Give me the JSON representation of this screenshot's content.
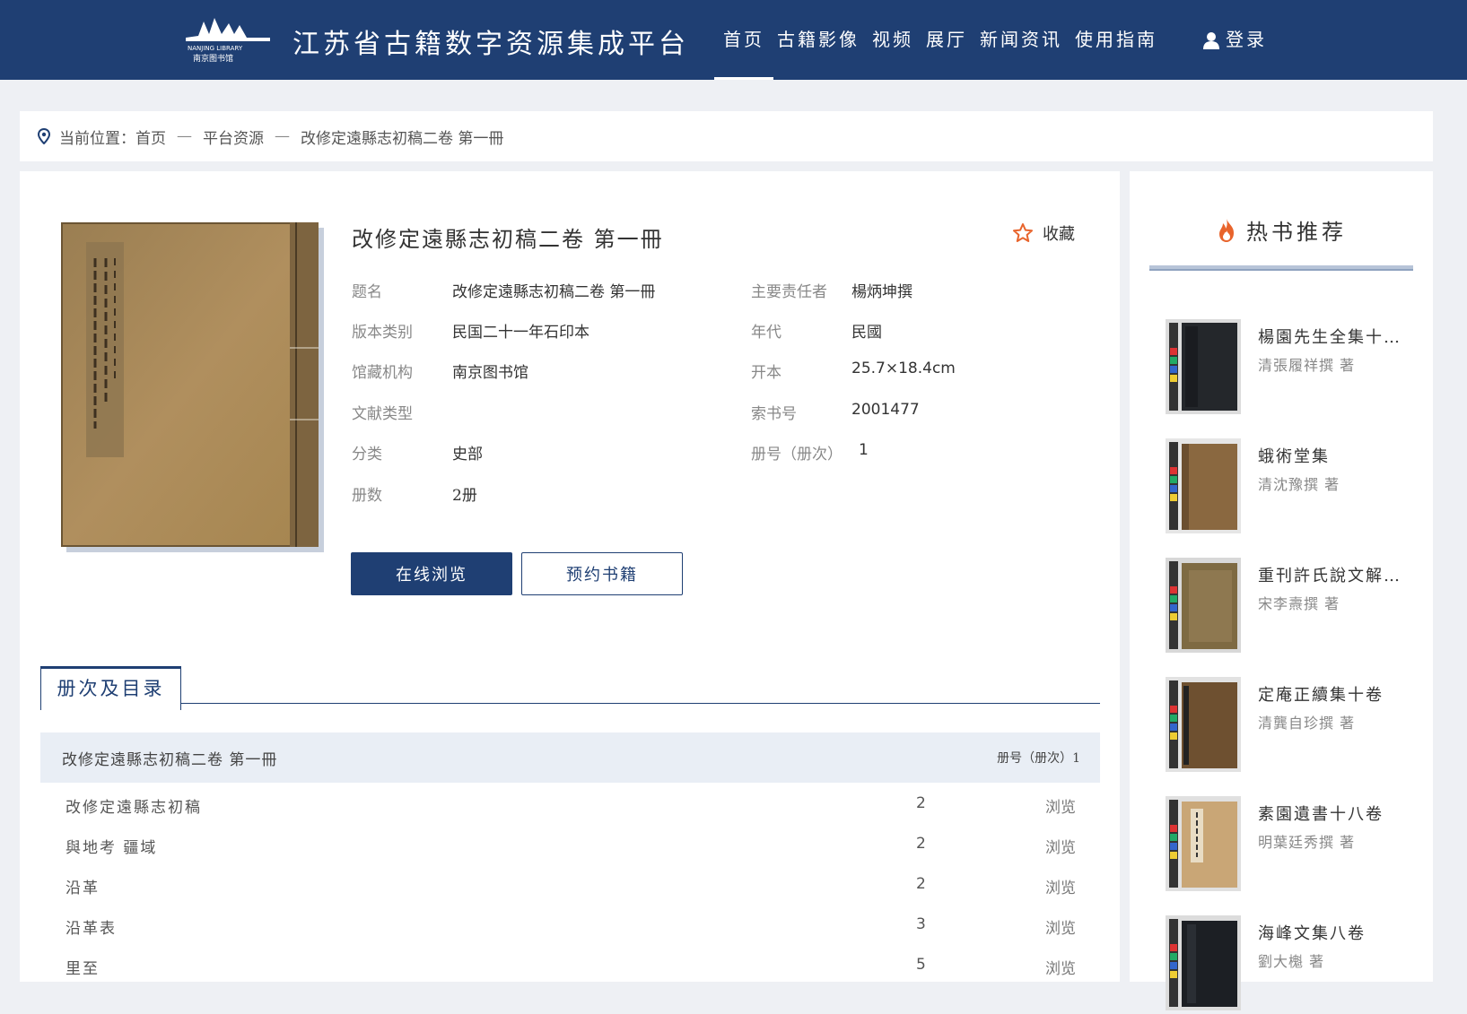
{
  "header": {
    "site_title": "江苏省古籍数字资源集成平台",
    "logo_text": "NANJING LIBRARY 南京图书馆",
    "nav": [
      "首页",
      "古籍影像",
      "视频",
      "展厅",
      "新闻资讯",
      "使用指南"
    ],
    "login": "登录"
  },
  "breadcrumb": {
    "label": "当前位置：",
    "items": [
      "首页",
      "平台资源",
      "改修定遠縣志初稿二卷 第一冊"
    ],
    "separator": "—"
  },
  "book": {
    "title": "改修定遠縣志初稿二卷 第一冊",
    "favorite": "收藏",
    "fields_left": [
      {
        "k": "题名",
        "v": "改修定遠縣志初稿二卷 第一冊"
      },
      {
        "k": "版本类别",
        "v": "民国二十一年石印本"
      },
      {
        "k": "馆藏机构",
        "v": "南京图书馆"
      },
      {
        "k": "文献类型",
        "v": ""
      },
      {
        "k": "分类",
        "v": "史部"
      },
      {
        "k": "册数",
        "v": "2册"
      }
    ],
    "fields_right": [
      {
        "k": "主要责任者",
        "v": "楊炳坤撰"
      },
      {
        "k": "年代",
        "v": "民國"
      },
      {
        "k": "开本",
        "v": "25.7×18.4cm"
      },
      {
        "k": "索书号",
        "v": "2001477"
      },
      {
        "k": "册号（册次）",
        "v": "1"
      }
    ],
    "btn_browse": "在线浏览",
    "btn_reserve": "预约书籍"
  },
  "toc": {
    "tab": "册次及目录",
    "head_title": "改修定遠縣志初稿二卷 第一冊",
    "head_volume": "册号（册次）1",
    "browse_label": "浏览",
    "rows": [
      {
        "t": "改修定遠縣志初稿",
        "n": "2"
      },
      {
        "t": "與地考 疆域",
        "n": "2"
      },
      {
        "t": "沿革",
        "n": "2"
      },
      {
        "t": "沿革表",
        "n": "3"
      },
      {
        "t": "里至",
        "n": "5"
      }
    ]
  },
  "sidebar": {
    "title": "热书推荐",
    "items": [
      {
        "t": "楊園先生全集十六卷",
        "a": "清張履祥撰 著"
      },
      {
        "t": "蛾術堂集",
        "a": "清沈豫撰 著"
      },
      {
        "t": "重刊許氏說文解字五音韻譜",
        "a": "宋李燾撰 著"
      },
      {
        "t": "定庵正續集十卷",
        "a": "清龔自珍撰 著"
      },
      {
        "t": "素園遺書十八卷",
        "a": "明葉廷秀撰 著"
      },
      {
        "t": "海峰文集八卷",
        "a": "劉大櫆 著"
      }
    ]
  },
  "colors": {
    "navy": "#1f3f73",
    "accent": "#e8642c"
  }
}
